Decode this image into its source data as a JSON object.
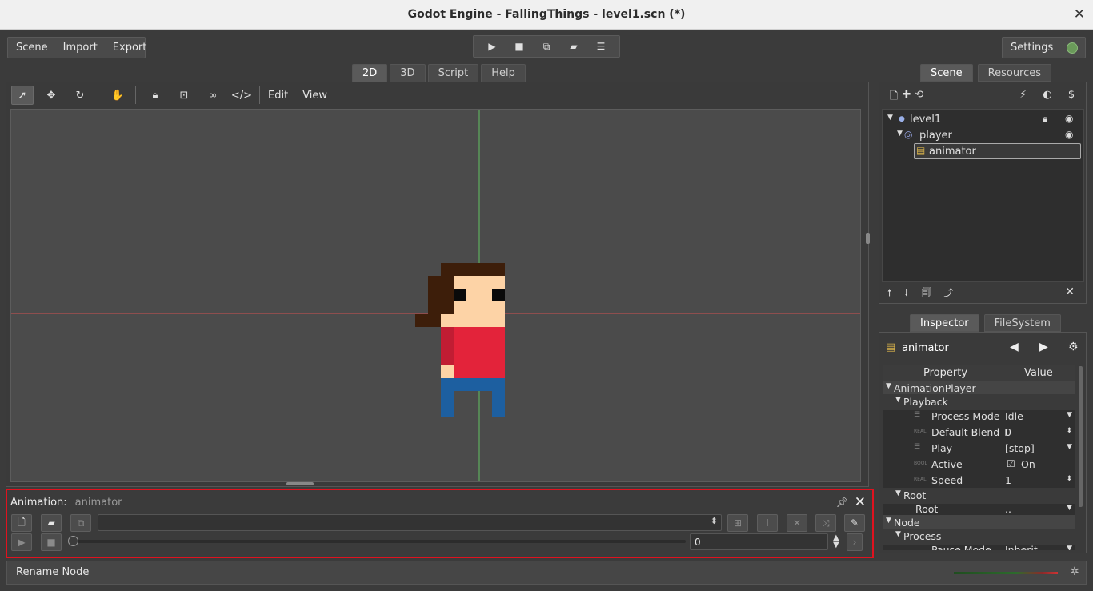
{
  "window": {
    "title": "Godot Engine - FallingThings - level1.scn (*)"
  },
  "menu": {
    "items": [
      "Scene",
      "Import",
      "Export"
    ]
  },
  "run_buttons": [
    "play-icon",
    "stop-icon",
    "play-scene-icon",
    "open-scene-icon",
    "menu-icon"
  ],
  "settings": {
    "label": "Settings"
  },
  "main_tabs": [
    {
      "label": "2D",
      "active": true
    },
    {
      "label": "3D",
      "active": false
    },
    {
      "label": "Script",
      "active": false
    },
    {
      "label": "Help",
      "active": false
    }
  ],
  "canvas_toolbar": {
    "edit": "Edit",
    "view": "View"
  },
  "animation_panel": {
    "label": "Animation:",
    "node": "animator",
    "time": "0"
  },
  "status_bar": {
    "text": "Rename Node"
  },
  "scene_dock": {
    "tabs": [
      {
        "label": "Scene",
        "active": true
      },
      {
        "label": "Resources",
        "active": false
      }
    ],
    "tree": [
      {
        "name": "level1",
        "depth": 0
      },
      {
        "name": "player",
        "depth": 1
      },
      {
        "name": "animator",
        "depth": 2,
        "selected": true
      }
    ]
  },
  "inspector_dock": {
    "tabs": [
      {
        "label": "Inspector",
        "active": true
      },
      {
        "label": "FileSystem",
        "active": false
      }
    ],
    "node_name": "animator",
    "columns": {
      "property": "Property",
      "value": "Value"
    },
    "rows": [
      {
        "kind": "section",
        "label": "AnimationPlayer"
      },
      {
        "kind": "sub",
        "label": "Playback"
      },
      {
        "kind": "prop",
        "type": "enum",
        "label": "Process Mode",
        "value": "Idle"
      },
      {
        "kind": "prop",
        "type": "REAL",
        "label": "Default Blend T",
        "value": "0"
      },
      {
        "kind": "prop",
        "type": "enum",
        "label": "Play",
        "value": "[stop]"
      },
      {
        "kind": "prop",
        "type": "BOOL",
        "label": "Active",
        "value": "On"
      },
      {
        "kind": "prop",
        "type": "REAL",
        "label": "Speed",
        "value": "1"
      },
      {
        "kind": "sub",
        "label": "Root"
      },
      {
        "kind": "prop",
        "type": "",
        "label": "Root",
        "value": ".."
      },
      {
        "kind": "section",
        "label": "Node"
      },
      {
        "kind": "sub",
        "label": "Process"
      },
      {
        "kind": "prop",
        "type": "",
        "label": "Pause Mode",
        "value": "Inherit"
      }
    ]
  },
  "colors": {
    "highlight_border": "#e0121f",
    "axis_x": "#d05050",
    "axis_y": "#60c060",
    "sprite_hair": "#3d1e0a",
    "sprite_skin": "#fdd3a6",
    "sprite_shirt": "#e3233a",
    "sprite_pants": "#1d5fa0"
  }
}
